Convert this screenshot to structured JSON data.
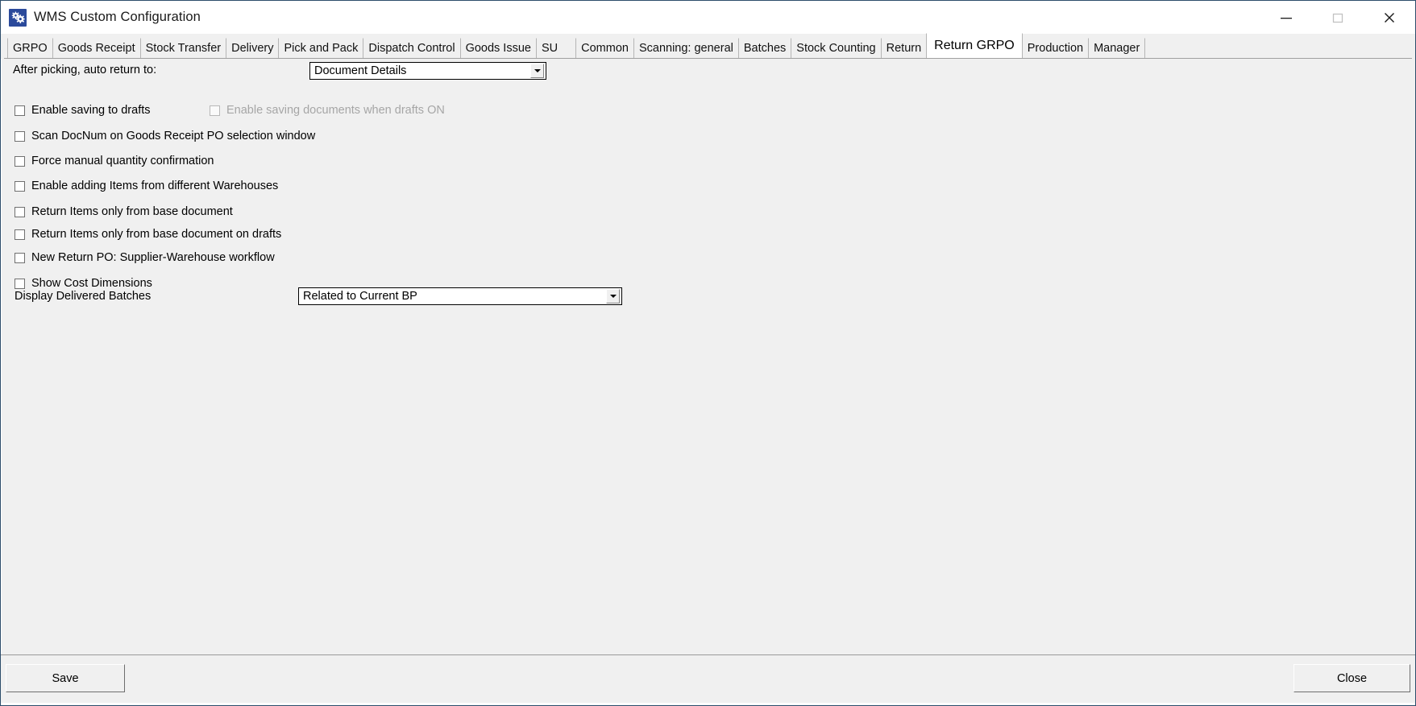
{
  "window": {
    "title": "WMS Custom Configuration",
    "icon": "gears-icon",
    "controls": {
      "minimize": "minimize-icon",
      "maximize": "maximize-icon",
      "close": "close-icon"
    }
  },
  "tabs": [
    {
      "label": "GRPO",
      "active": false
    },
    {
      "label": "Goods Receipt",
      "active": false
    },
    {
      "label": "Stock Transfer",
      "active": false
    },
    {
      "label": "Delivery",
      "active": false
    },
    {
      "label": "Pick and Pack",
      "active": false
    },
    {
      "label": "Dispatch Control",
      "active": false
    },
    {
      "label": "Goods Issue",
      "active": false
    },
    {
      "label": "SU",
      "active": false
    },
    {
      "label": "Common",
      "active": false
    },
    {
      "label": "Scanning: general",
      "active": false
    },
    {
      "label": "Batches",
      "active": false
    },
    {
      "label": "Stock Counting",
      "active": false
    },
    {
      "label": "Return",
      "active": false
    },
    {
      "label": "Return GRPO",
      "active": true
    },
    {
      "label": "Production",
      "active": false
    },
    {
      "label": "Manager",
      "active": false
    }
  ],
  "form": {
    "auto_return": {
      "label": "After picking, auto return to:",
      "value": "Document Details"
    },
    "checkboxes": [
      {
        "label": "Enable saving to drafts",
        "checked": false,
        "disabled": false
      },
      {
        "label": "Enable saving documents when drafts ON",
        "checked": false,
        "disabled": true
      },
      {
        "label": "Scan DocNum on Goods Receipt PO selection window",
        "checked": false,
        "disabled": false
      },
      {
        "label": "Force manual quantity confirmation",
        "checked": false,
        "disabled": false
      },
      {
        "label": "Enable adding Items from different Warehouses",
        "checked": false,
        "disabled": false
      },
      {
        "label": "Return Items only from base document",
        "checked": false,
        "disabled": false
      },
      {
        "label": "Return Items only from base document on drafts",
        "checked": false,
        "disabled": false
      },
      {
        "label": "New Return PO: Supplier-Warehouse workflow",
        "checked": false,
        "disabled": false
      },
      {
        "label": "Show Cost Dimensions",
        "checked": false,
        "disabled": false
      }
    ],
    "delivered_batches": {
      "label": "Display Delivered Batches",
      "value": "Related to Current BP"
    }
  },
  "footer": {
    "save_label": "Save",
    "close_label": "Close"
  },
  "colors": {
    "window_border": "#2d4d6b",
    "face": "#f0f0f0",
    "titlebar": "#ffffff",
    "icon_blue": "#2b4a9b",
    "text": "#000000",
    "disabled_text": "#a6a6a6"
  }
}
